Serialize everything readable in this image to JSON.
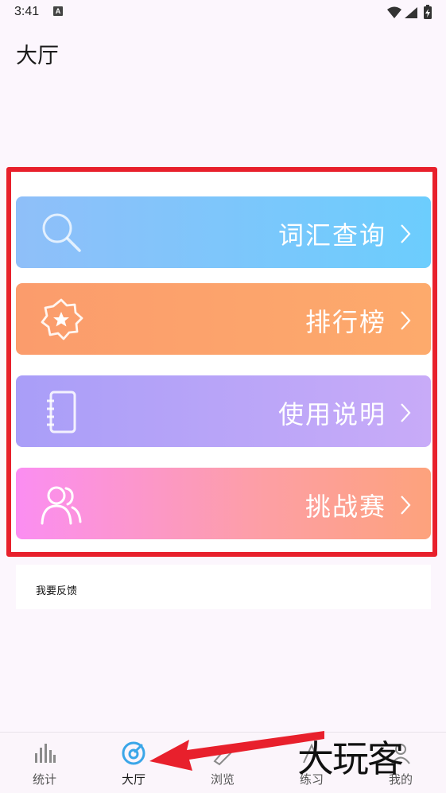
{
  "status_bar": {
    "time": "3:41",
    "notification_badge": "A",
    "icons": [
      "wifi-icon",
      "signal-icon",
      "battery-charging-icon"
    ]
  },
  "header": {
    "title": "大厅"
  },
  "features": [
    {
      "label": "词汇查询",
      "icon": "search-icon",
      "colors": [
        "#8fbff9",
        "#6ccdfd"
      ]
    },
    {
      "label": "排行榜",
      "icon": "star-badge-icon",
      "colors": [
        "#fb9c6c",
        "#fdaa6c"
      ]
    },
    {
      "label": "使用说明",
      "icon": "notebook-icon",
      "colors": [
        "#a99ef8",
        "#c8abf8"
      ]
    },
    {
      "label": "挑战赛",
      "icon": "users-icon",
      "colors": [
        "#fb8ef2",
        "#fda27c"
      ]
    }
  ],
  "feedback": {
    "label": "我要反馈"
  },
  "bottom_nav": {
    "items": [
      {
        "label": "统计",
        "icon": "bar-chart-icon",
        "active": false
      },
      {
        "label": "大厅",
        "icon": "hall-target-icon",
        "active": true
      },
      {
        "label": "浏览",
        "icon": "browse-icon",
        "active": false
      },
      {
        "label": "练习",
        "icon": "practice-icon",
        "active": false
      },
      {
        "label": "我的",
        "icon": "profile-icon",
        "active": false
      }
    ],
    "active_color": "#3aa6e8"
  },
  "annotation": {
    "highlight_color": "#e8202c"
  },
  "watermark": {
    "text": "大玩客"
  }
}
